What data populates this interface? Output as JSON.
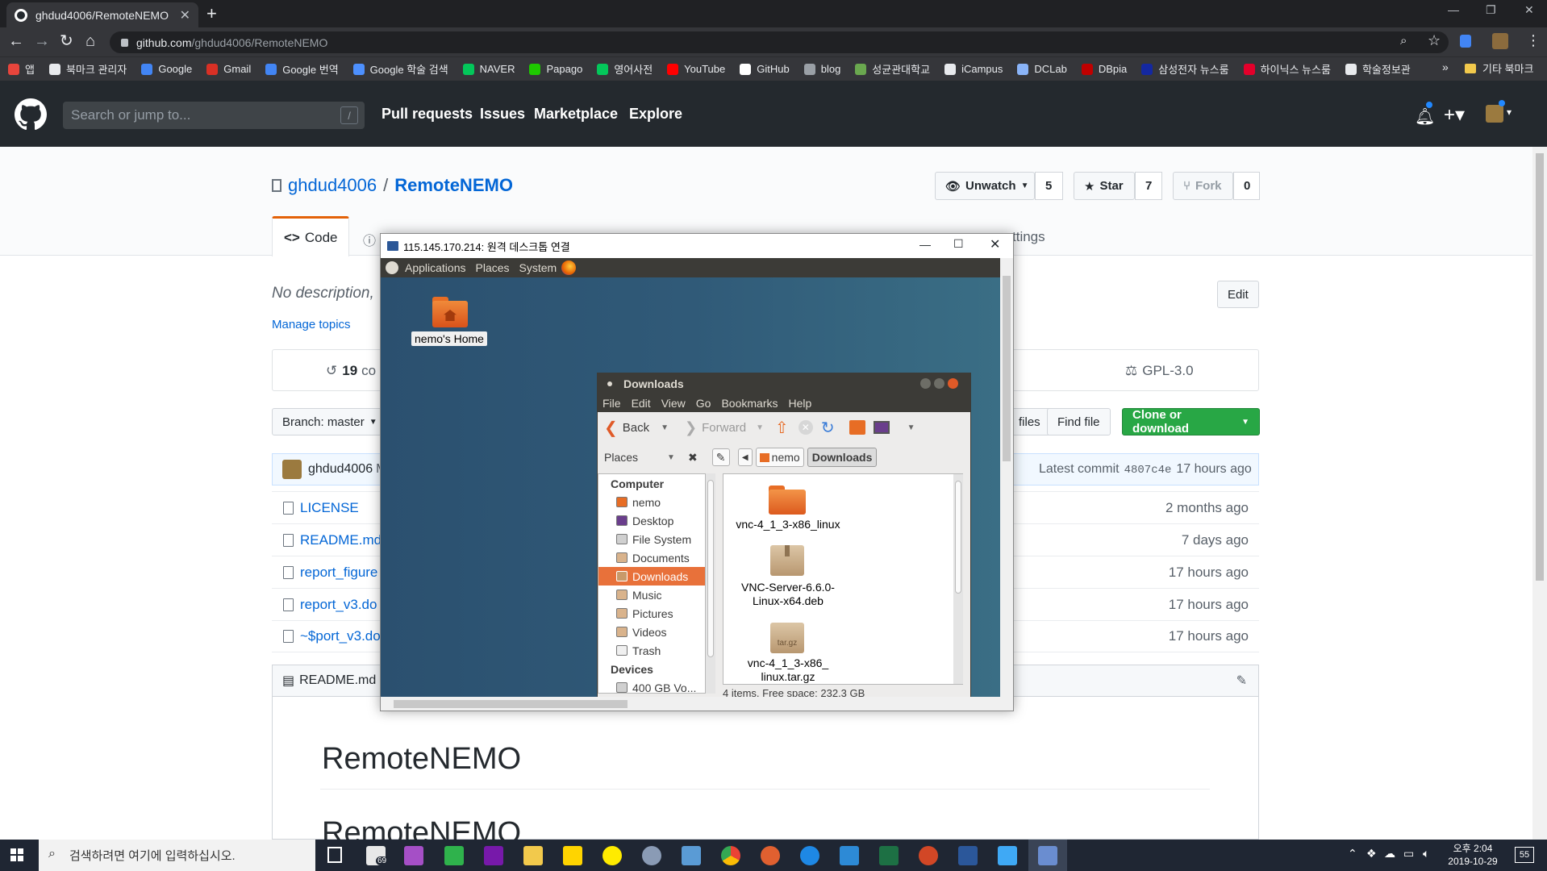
{
  "browser": {
    "tab_title": "ghdud4006/RemoteNEMO",
    "url_domain": "github.com",
    "url_path": "/ghdud4006/RemoteNEMO",
    "bookmarks": [
      {
        "label": "앱",
        "color": "#e8453c"
      },
      {
        "label": "북마크 관리자",
        "color": "#e8eaed"
      },
      {
        "label": "Google",
        "color": "#4285f4"
      },
      {
        "label": "Gmail",
        "color": "#d93025"
      },
      {
        "label": "Google 번역",
        "color": "#4285f4"
      },
      {
        "label": "Google 학술 검색",
        "color": "#4d90fe"
      },
      {
        "label": "NAVER",
        "color": "#03c75a"
      },
      {
        "label": "Papago",
        "color": "#1ec800"
      },
      {
        "label": "영어사전",
        "color": "#03c75a"
      },
      {
        "label": "YouTube",
        "color": "#ff0000"
      },
      {
        "label": "GitHub",
        "color": "#ffffff"
      },
      {
        "label": "blog",
        "color": "#9aa0a6"
      },
      {
        "label": "성균관대학교",
        "color": "#6aa84f"
      },
      {
        "label": "iCampus",
        "color": "#e8eaed"
      },
      {
        "label": "DCLab",
        "color": "#8ab4f8"
      },
      {
        "label": "DBpia",
        "color": "#c00000"
      },
      {
        "label": "삼성전자 뉴스룸",
        "color": "#1428a0"
      },
      {
        "label": "하이닉스 뉴스룸",
        "color": "#e4002b"
      },
      {
        "label": "학술정보관",
        "color": "#e8eaed"
      }
    ],
    "bookmarks_more": "»",
    "other_bookmarks": "기타 북마크"
  },
  "github": {
    "search_placeholder": "Search or jump to...",
    "search_hint": "/",
    "nav": [
      "Pull requests",
      "Issues",
      "Marketplace",
      "Explore"
    ],
    "owner": "ghdud4006",
    "separator": "/",
    "repo": "RemoteNEMO",
    "watch_label": "Unwatch",
    "watch_count": "5",
    "star_label": "Star",
    "star_count": "7",
    "fork_label": "Fork",
    "fork_count": "0",
    "code_tab": "Code",
    "settings_tab_partial": "ttings",
    "description": "No description,",
    "edit_label": "Edit",
    "manage_topics": "Manage topics",
    "commits_count": "19",
    "commits_label_partial": "co",
    "license": "GPL-3.0",
    "branch_label": "Branch: master",
    "files_partial": "files",
    "find_file": "Find file",
    "clone_label": "Clone or download",
    "commit_author": "ghdud4006",
    "commit_author_suffix": "M",
    "latest_commit_label": "Latest commit",
    "latest_commit_sha": "4807c4e",
    "latest_commit_age": "17 hours ago",
    "files": [
      {
        "name": "LICENSE",
        "age": "2 months ago"
      },
      {
        "name": "README.md",
        "age": "7 days ago"
      },
      {
        "name": "report_figure",
        "age": "17 hours ago"
      },
      {
        "name": "report_v3.do",
        "age": "17 hours ago"
      },
      {
        "name": "~$port_v3.do",
        "age": "17 hours ago"
      }
    ],
    "readme_label": "README.md",
    "readme_heading": "RemoteNEMO",
    "readme_heading2": "RemoteNEMO"
  },
  "rdp": {
    "title": "115.145.170.214: 원격 데스크톱 연결",
    "panel_menu": [
      "Applications",
      "Places",
      "System"
    ],
    "desktop_icon_label": "nemo's Home"
  },
  "nautilus": {
    "title": "Downloads",
    "menu": [
      "File",
      "Edit",
      "View",
      "Go",
      "Bookmarks",
      "Help"
    ],
    "back": "Back",
    "forward": "Forward",
    "places_label": "Places",
    "path": [
      "nemo",
      "Downloads"
    ],
    "sidebar_computer": "Computer",
    "sidebar_items": [
      "nemo",
      "Desktop",
      "File System",
      "Documents",
      "Downloads",
      "Music",
      "Pictures",
      "Videos",
      "Trash"
    ],
    "sidebar_devices": "Devices",
    "sidebar_device_item": "400 GB Vo...",
    "files": [
      {
        "name": "vnc-4_1_3-x86_linux"
      },
      {
        "name": "VNC-Server-6.6.0-\nLinux-x64.deb"
      },
      {
        "name": "vnc-4_1_3-x86_\nlinux.tar.gz"
      }
    ],
    "tar_label": "tar.gz",
    "status": "4 items, Free space: 232.3 GB"
  },
  "taskbar": {
    "search_placeholder": "검색하려면 여기에 입력하십시오.",
    "mail_badge": "69",
    "clock_time": "오후 2:04",
    "clock_date": "2019-10-29",
    "notif_count": "55"
  }
}
